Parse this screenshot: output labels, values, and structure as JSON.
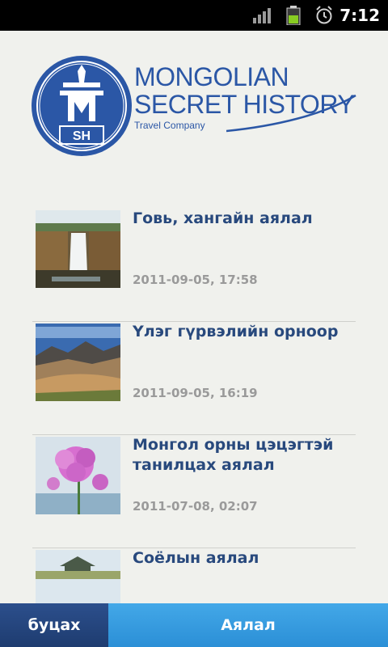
{
  "status_bar": {
    "time": "7:12",
    "icons": [
      "signal-icon",
      "battery-icon",
      "alarm-icon"
    ]
  },
  "header": {
    "logo_line1": "MONGOLIAN",
    "logo_line2": "SECRET HISTORY",
    "logo_line3": "Travel Company",
    "emblem_letters": "SH",
    "brand_color": "#2b57a6"
  },
  "tours": [
    {
      "title": "Говь, хангайн аялал",
      "date": "2011-09-05, 17:58"
    },
    {
      "title": "Үлэг гүрвэлийн орноор",
      "date": "2011-09-05, 16:19"
    },
    {
      "title": "Монгол орны цэцэгтэй танилцах аялал",
      "date": "2011-07-08, 02:07"
    },
    {
      "title": "Соёлын аялал",
      "date": ""
    }
  ],
  "bottom_bar": {
    "back_label": "буцах",
    "title": "Аялал"
  },
  "colors": {
    "title_text": "#28497d",
    "date_text": "#9a9a9a",
    "back_button": "#23447e",
    "bar": "#3a9de0"
  }
}
